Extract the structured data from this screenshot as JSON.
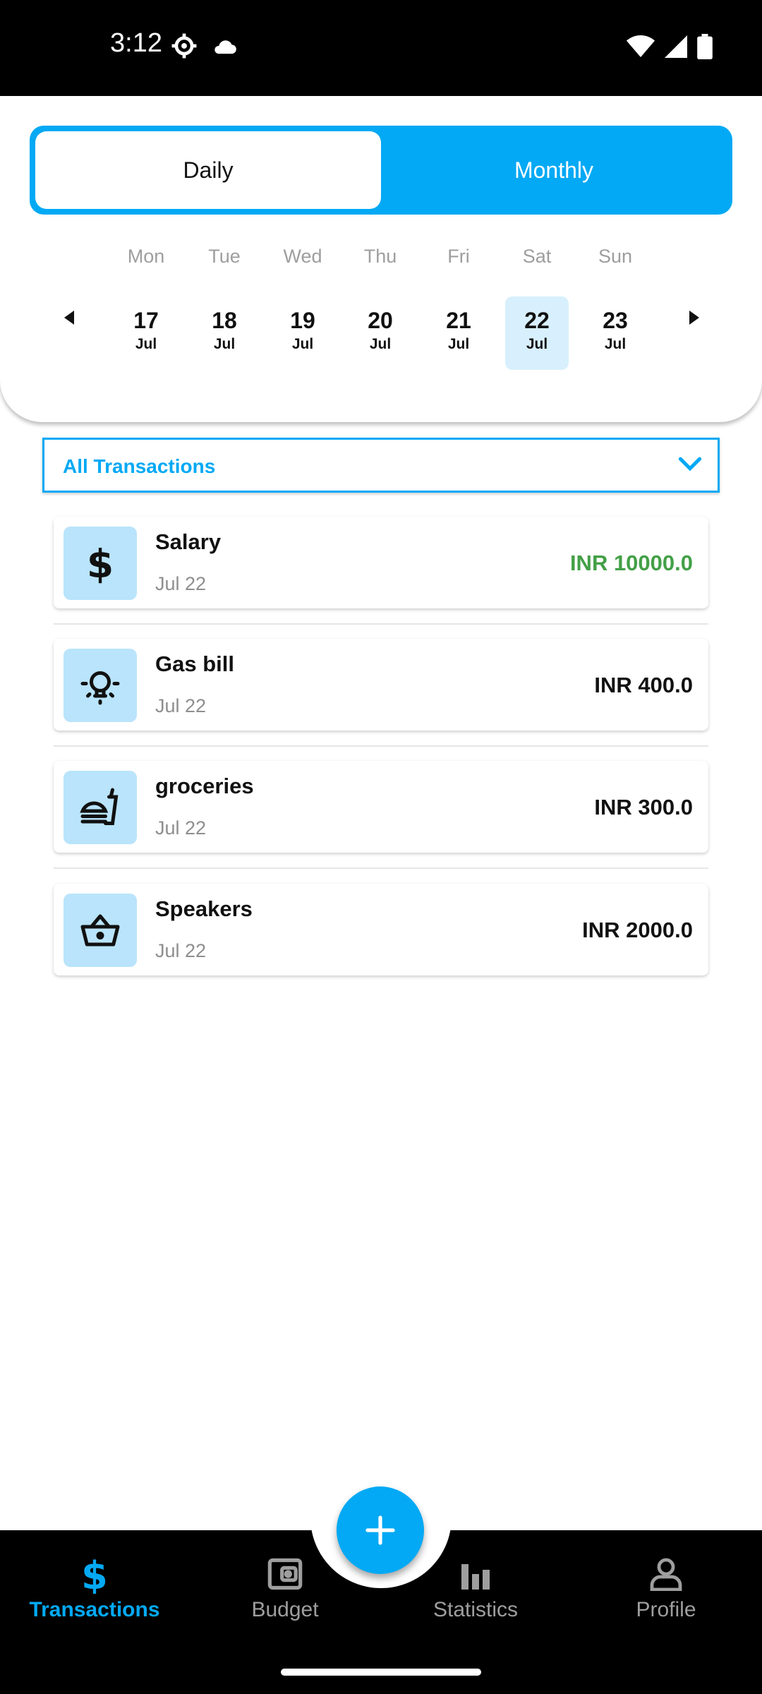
{
  "status_bar": {
    "time": "3:12"
  },
  "view_toggle": {
    "daily": "Daily",
    "monthly": "Monthly",
    "selected": "Daily"
  },
  "week": {
    "days": [
      {
        "name": "Mon",
        "num": "17",
        "month": "Jul",
        "selected": false
      },
      {
        "name": "Tue",
        "num": "18",
        "month": "Jul",
        "selected": false
      },
      {
        "name": "Wed",
        "num": "19",
        "month": "Jul",
        "selected": false
      },
      {
        "name": "Thu",
        "num": "20",
        "month": "Jul",
        "selected": false
      },
      {
        "name": "Fri",
        "num": "21",
        "month": "Jul",
        "selected": false
      },
      {
        "name": "Sat",
        "num": "22",
        "month": "Jul",
        "selected": true
      },
      {
        "name": "Sun",
        "num": "23",
        "month": "Jul",
        "selected": false
      }
    ]
  },
  "filter": {
    "label": "All Transactions"
  },
  "transactions": [
    {
      "title": "Salary",
      "date": "Jul 22",
      "amount": "INR 10000.0",
      "type": "income",
      "icon": "dollar-icon"
    },
    {
      "title": "Gas bill",
      "date": "Jul 22",
      "amount": "INR 400.0",
      "type": "expense",
      "icon": "bulb-icon"
    },
    {
      "title": "groceries",
      "date": "Jul 22",
      "amount": "INR 300.0",
      "type": "expense",
      "icon": "fast-food-icon"
    },
    {
      "title": "Speakers",
      "date": "Jul 22",
      "amount": "INR 2000.0",
      "type": "expense",
      "icon": "basket-icon"
    }
  ],
  "bottom_nav": {
    "items": [
      {
        "label": "Transactions",
        "icon": "dollar-icon",
        "active": true
      },
      {
        "label": "Budget",
        "icon": "wallet-icon",
        "active": false
      },
      {
        "label": "Statistics",
        "icon": "bar-chart-icon",
        "active": false
      },
      {
        "label": "Profile",
        "icon": "person-icon",
        "active": false
      }
    ]
  },
  "colors": {
    "accent": "#03a9f4",
    "income": "#43a047",
    "icon_bg": "#b9e4fb",
    "selected_day_bg": "#d8f0fd"
  }
}
